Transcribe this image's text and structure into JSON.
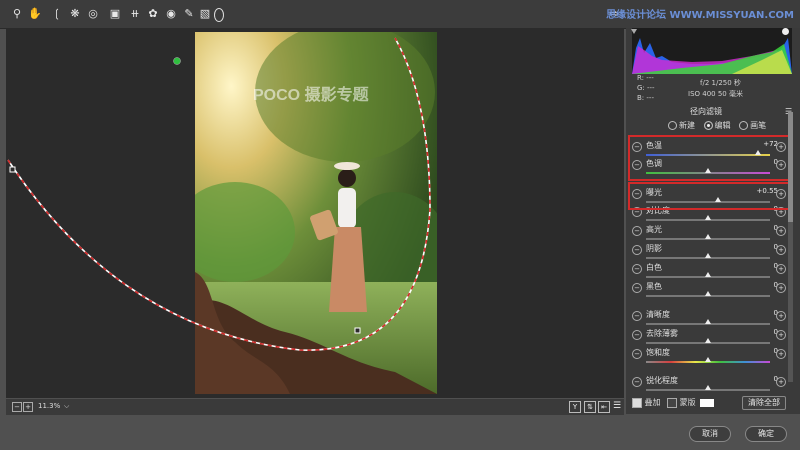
{
  "watermark": "思缘设计论坛 WWW.MISSYUAN.COM",
  "toolbar": {
    "tools": [
      "zoom-icon",
      "hand-icon",
      "white-balance-icon",
      "color-sampler-icon",
      "target-adjust-icon",
      "crop-icon",
      "straighten-icon",
      "spot-removal-icon",
      "redeye-icon",
      "adjustment-brush-icon",
      "graduated-filter-icon",
      "radial-filter-icon"
    ],
    "export_icon": "export-icon",
    "fullscreen_icon": "fullscreen-icon"
  },
  "photo": {
    "watermark_text": "POCO 摄影专题"
  },
  "readout": {
    "r": "R:  ---",
    "g": "G:  ---",
    "b": "B:  ---",
    "aperture_shutter": "f/2   1/250 秒",
    "iso_focal": "ISO 400   50 毫米"
  },
  "panel": {
    "title": "径向滤镜",
    "mode_options": [
      "新建",
      "编辑",
      "画笔"
    ],
    "selected_mode": "编辑",
    "sliders": [
      {
        "label": "色温",
        "value": "+72",
        "pos": 0.9
      },
      {
        "label": "色调",
        "value": "0",
        "pos": 0.5
      },
      {
        "label": "曝光",
        "value": "+0.55",
        "pos": 0.58
      },
      {
        "label": "对比度",
        "value": "0",
        "pos": 0.5
      },
      {
        "label": "高光",
        "value": "0",
        "pos": 0.5
      },
      {
        "label": "阴影",
        "value": "0",
        "pos": 0.5
      },
      {
        "label": "白色",
        "value": "0",
        "pos": 0.5
      },
      {
        "label": "黑色",
        "value": "0",
        "pos": 0.5
      },
      {
        "label": "清晰度",
        "value": "0",
        "pos": 0.5
      },
      {
        "label": "去除薄雾",
        "value": "0",
        "pos": 0.5
      },
      {
        "label": "饱和度",
        "value": "0",
        "pos": 0.5
      },
      {
        "label": "锐化程度",
        "value": "0",
        "pos": 0.5
      }
    ],
    "overlay_label": "叠加",
    "mask_label": "蒙版",
    "clear_all": "清除全部"
  },
  "statusbar": {
    "zoom": "11.3%"
  },
  "footer": {
    "cancel": "取消",
    "ok": "确定"
  }
}
